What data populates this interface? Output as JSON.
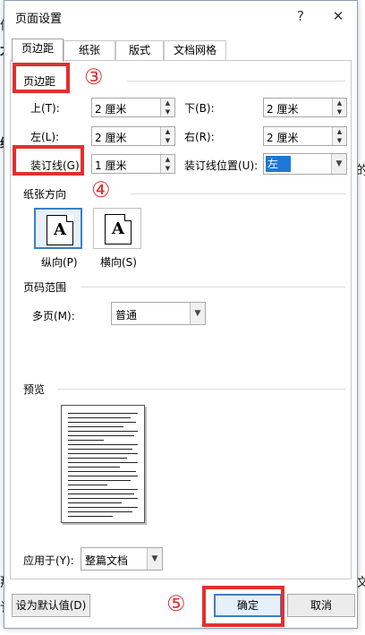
{
  "dialog": {
    "title": "页面设置",
    "help_label": "?",
    "close_label": "✕"
  },
  "tabs": [
    {
      "label": "页边距",
      "active": true
    },
    {
      "label": "纸张",
      "active": false
    },
    {
      "label": "版式",
      "active": false
    },
    {
      "label": "文档网格",
      "active": false
    }
  ],
  "margins": {
    "group_label": "页边距",
    "top_label": "上(T):",
    "top_value": "2 厘米",
    "bottom_label": "下(B):",
    "bottom_value": "2 厘米",
    "left_label": "左(L):",
    "left_value": "2 厘米",
    "right_label": "右(R):",
    "right_value": "2 厘米",
    "gutter_label": "装订线(G):",
    "gutter_value": "1 厘米",
    "gutter_pos_label": "装订线位置(U):",
    "gutter_pos_value": "左"
  },
  "orientation": {
    "group_label": "纸张方向",
    "icon_letter": "A",
    "portrait_label": "纵向(P)",
    "landscape_label": "横向(S)",
    "selected": "portrait"
  },
  "pages": {
    "group_label": "页码范围",
    "multi_label": "多页(M):",
    "multi_value": "普通"
  },
  "preview": {
    "group_label": "预览"
  },
  "apply": {
    "label": "应用于(Y):",
    "value": "整篇文档"
  },
  "buttons": {
    "set_default": "设为默认值(D)",
    "ok": "确定",
    "cancel": "取消"
  },
  "annotations": {
    "step3": "③",
    "step4": "④",
    "step5": "⑤"
  },
  "background_glyphs": {
    "left": [
      "仿",
      "太",
      "绕",
      "ト",
      "那",
      "讠"
    ],
    "right": [
      "的",
      "文"
    ]
  },
  "colors": {
    "highlight_red": "#e03030",
    "selection_blue": "#1e78d7",
    "accent_border": "#3c7fc4"
  }
}
